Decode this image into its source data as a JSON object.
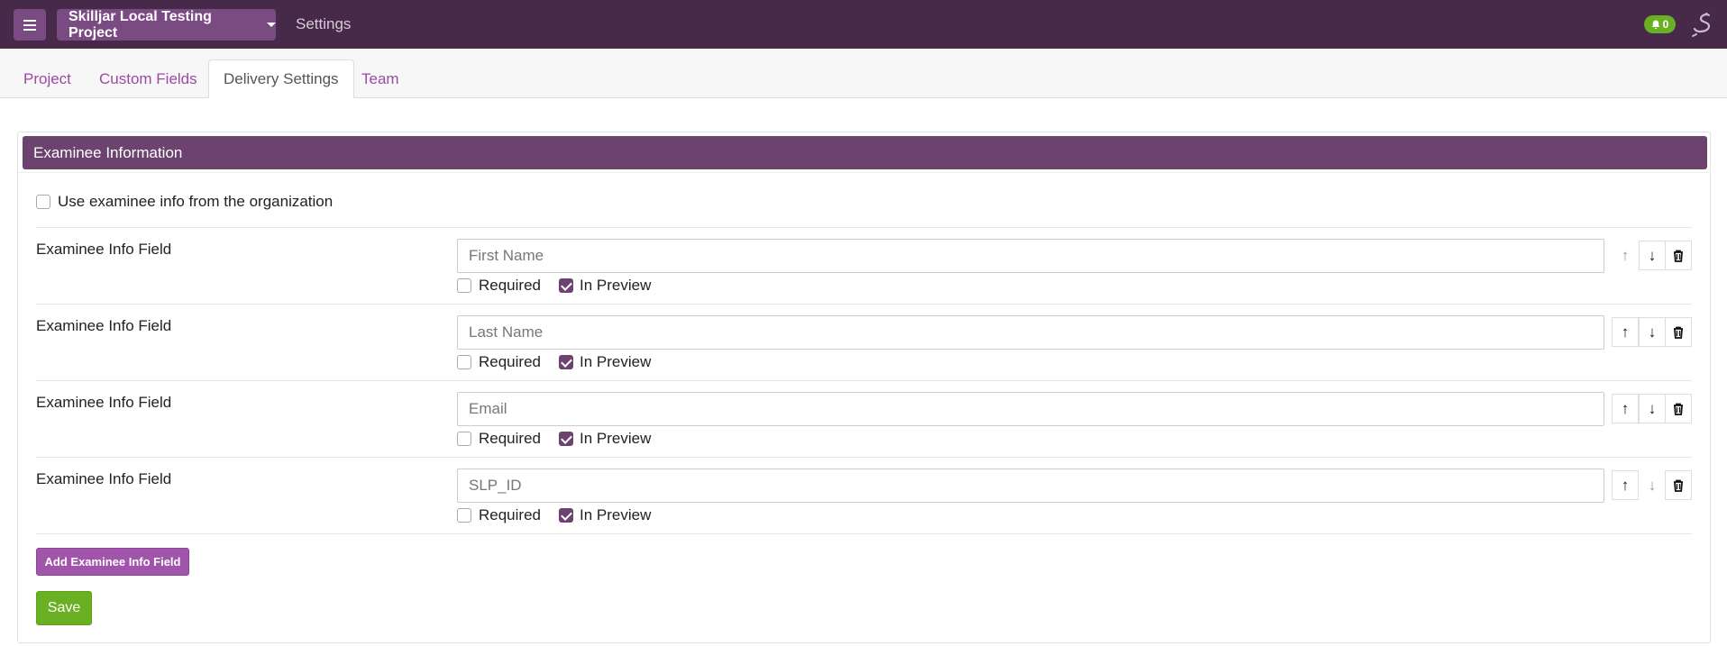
{
  "topbar": {
    "project_name": "Skilljar Local Testing Project",
    "settings_link": "Settings",
    "notification_count": "0"
  },
  "tabs": [
    {
      "label": "Project",
      "active": false
    },
    {
      "label": "Custom Fields",
      "active": false
    },
    {
      "label": "Delivery Settings",
      "active": true
    },
    {
      "label": "Team",
      "active": false
    }
  ],
  "panel": {
    "title": "Examinee Information",
    "use_org_info_label": "Use examinee info from the organization",
    "use_org_info_checked": false,
    "fields": [
      {
        "label": "Examinee Info Field",
        "placeholder": "First Name",
        "required_label": "Required",
        "required": false,
        "preview_label": "In Preview",
        "in_preview": true
      },
      {
        "label": "Examinee Info Field",
        "placeholder": "Last Name",
        "required_label": "Required",
        "required": false,
        "preview_label": "In Preview",
        "in_preview": true
      },
      {
        "label": "Examinee Info Field",
        "placeholder": "Email",
        "required_label": "Required",
        "required": false,
        "preview_label": "In Preview",
        "in_preview": true
      },
      {
        "label": "Examinee Info Field",
        "placeholder": "SLP_ID",
        "required_label": "Required",
        "required": false,
        "preview_label": "In Preview",
        "in_preview": true
      }
    ],
    "add_button": "Add Examinee Info Field",
    "save_button": "Save"
  },
  "icons": {
    "menu": "hamburger-icon",
    "bell": "bell-icon",
    "user": "skilljar-logo-icon",
    "up": "arrow-up-icon",
    "down": "arrow-down-icon",
    "delete": "trash-icon"
  },
  "colors": {
    "topbar": "#472a4a",
    "accent": "#6c426f",
    "link": "#9b4aa5",
    "success": "#6ab023"
  }
}
